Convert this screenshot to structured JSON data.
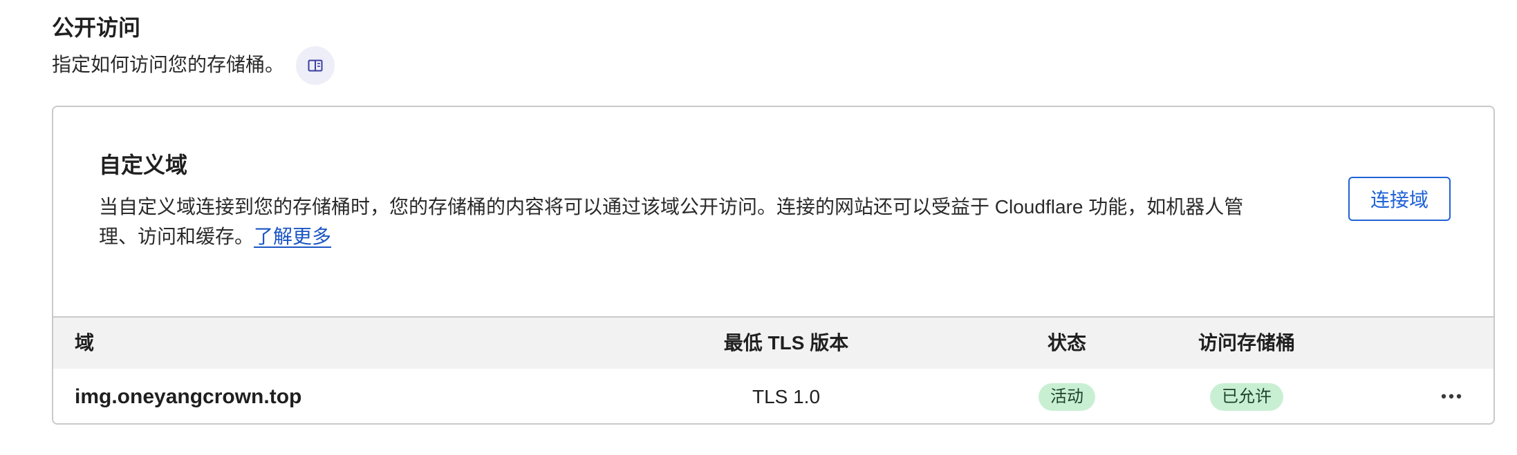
{
  "public_access": {
    "title": "公开访问",
    "description": "指定如何访问您的存储桶。",
    "doc_icon": "book-open-icon"
  },
  "custom_domains": {
    "title": "自定义域",
    "description": "当自定义域连接到您的存储桶时，您的存储桶的内容将可以通过该域公开访问。连接的网站还可以受益于 Cloudflare 功能，如机器人管理、访问和缓存。",
    "learn_more": "了解更多",
    "connect_button": "连接域",
    "accent_color": "#1f62d6",
    "table": {
      "headers": {
        "domain": "域",
        "min_tls": "最低 TLS 版本",
        "status": "状态",
        "bucket_access": "访问存储桶"
      },
      "rows": [
        {
          "domain": "img.oneyangcrown.top",
          "min_tls": "TLS 1.0",
          "status": "活动",
          "bucket_access": "已允许",
          "actions_icon": "more-horizontal-icon"
        }
      ],
      "badge_color": "#c9efd3"
    }
  }
}
